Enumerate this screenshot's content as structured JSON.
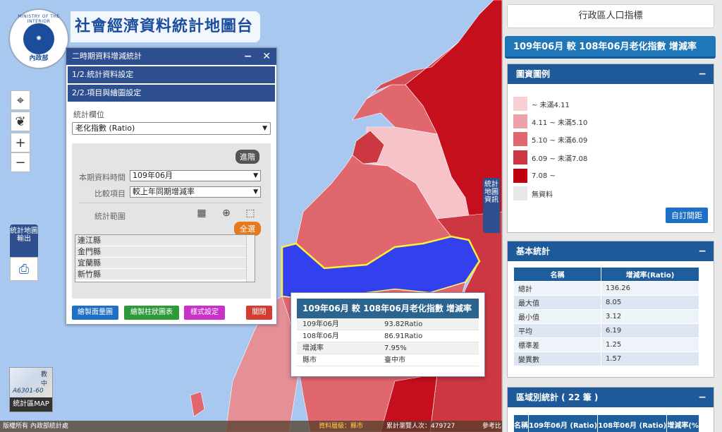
{
  "site": {
    "title": "社會經濟資料統計地圖台",
    "logo_ring": "MINISTRY OF THE INTERIOR",
    "logo_bottom": "內政部"
  },
  "map_controls": {
    "export_label": "統計地圖輸出",
    "side_tab_label": "統計地圖資訊",
    "mini_map_label": "統計區MAP",
    "mini_map_text": "A6301-60",
    "mini_map_sign": "教中"
  },
  "left_panel": {
    "title": "二時期資料增減統計",
    "step1": "1/2.統計資料設定",
    "step2": "2/2.項目與繪圖設定",
    "stat_field_label": "統計欄位",
    "stat_field_value": "老化指數 (Ratio)",
    "advanced_button": "進階",
    "period_label": "本期資料時間",
    "period_value": "109年06月",
    "compare_label": "比較項目",
    "compare_value": "較上年同期增減率",
    "range_label": "統計範圍",
    "select_all": "全選",
    "counties": [
      "連江縣",
      "金門縣",
      "宜蘭縣",
      "新竹縣"
    ],
    "buttons": {
      "area_map": "繪製面量圖",
      "bar_chart": "繪製柱狀圖表",
      "style": "樣式設定",
      "close": "關閉"
    }
  },
  "popup": {
    "title": "109年06月 較 108年06月老化指數 增減率",
    "rows": [
      {
        "k": "109年06月",
        "v": "93.82Ratio"
      },
      {
        "k": "108年06月",
        "v": "86.91Ratio"
      },
      {
        "k": "增減率",
        "v": "7.95%"
      },
      {
        "k": "縣市",
        "v": "臺中市"
      }
    ]
  },
  "status_bar": {
    "copyright": "版權所有 內政部統計處",
    "level": "資料層級：縣市",
    "visits": "累計瀏覽人次：479727",
    "ref": "參考比"
  },
  "right_panel": {
    "title": "行政區人口指標",
    "banner": "109年06月 較 108年06月老化指數 增減率",
    "legend_title": "圖資圖例",
    "legend": [
      {
        "label": "~ 未滿4.11",
        "color": "#f8cfd3"
      },
      {
        "label": "4.11 ~ 未滿5.10",
        "color": "#eda1a8"
      },
      {
        "label": "5.10 ~ 未滿6.09",
        "color": "#e0676e"
      },
      {
        "label": "6.09 ~ 未滿7.08",
        "color": "#cd3742"
      },
      {
        "label": "7.08 ~",
        "color": "#c0000e"
      },
      {
        "label": "無資料",
        "color": "#e8e8e8"
      }
    ],
    "custom_button": "自訂間距",
    "basic_title": "基本統計",
    "basic_headers": [
      "名稱",
      "增減率(Ratio)"
    ],
    "basic_rows": [
      [
        "總計",
        "136.26"
      ],
      [
        "最大值",
        "8.05"
      ],
      [
        "最小值",
        "3.12"
      ],
      [
        "平均",
        "6.19"
      ],
      [
        "標準差",
        "1.25"
      ],
      [
        "變異數",
        "1.57"
      ]
    ],
    "region_title": "區域別統計 ( 22 筆 )",
    "region_headers": [
      "名稱",
      "109年06月 (Ratio)",
      "108年06月 (Ratio)",
      "增減率(%"
    ]
  }
}
